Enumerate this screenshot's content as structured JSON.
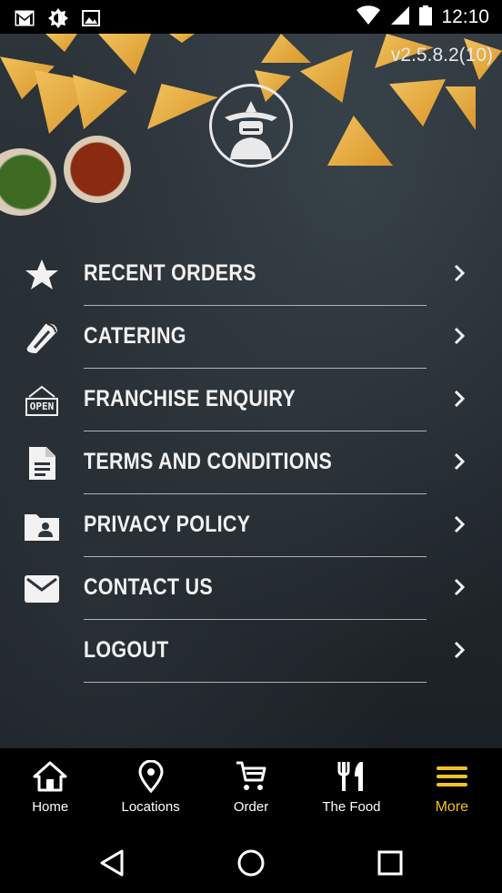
{
  "status_bar": {
    "time": "12:10",
    "icons": [
      "gmail-icon",
      "brightness-icon",
      "image-icon",
      "wifi-icon",
      "signal-icon",
      "battery-icon"
    ]
  },
  "app": {
    "version": "v2.5.8.2(10)",
    "logo": "sombrero-man-logo"
  },
  "menu": {
    "items": [
      {
        "label": "RECENT ORDERS",
        "icon": "star-icon"
      },
      {
        "label": "CATERING",
        "icon": "burrito-icon"
      },
      {
        "label": "FRANCHISE ENQUIRY",
        "icon": "open-sign-icon"
      },
      {
        "label": "TERMS AND CONDITIONS",
        "icon": "document-icon"
      },
      {
        "label": "PRIVACY POLICY",
        "icon": "contact-folder-icon"
      },
      {
        "label": "CONTACT US",
        "icon": "mail-icon"
      },
      {
        "label": "LOGOUT",
        "icon": ""
      }
    ],
    "open_sign_text": "OPEN"
  },
  "bottom_nav": {
    "items": [
      {
        "label": "Home",
        "icon": "home-icon"
      },
      {
        "label": "Locations",
        "icon": "location-pin-icon"
      },
      {
        "label": "Order",
        "icon": "cart-icon"
      },
      {
        "label": "The Food",
        "icon": "fork-knife-icon"
      },
      {
        "label": "More",
        "icon": "menu-lines-icon",
        "active": true
      }
    ],
    "active_color": "#f0c127"
  },
  "system_nav": [
    "back-icon",
    "home-circle-icon",
    "recents-icon"
  ]
}
